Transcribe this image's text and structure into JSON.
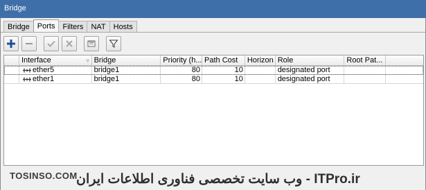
{
  "window": {
    "title": "Bridge"
  },
  "tabs": [
    {
      "label": "Bridge",
      "active": false
    },
    {
      "label": "Ports",
      "active": true
    },
    {
      "label": "Filters",
      "active": false
    },
    {
      "label": "NAT",
      "active": false
    },
    {
      "label": "Hosts",
      "active": false
    }
  ],
  "toolbar": {
    "add": "plus-icon",
    "remove": "minus-icon",
    "enable": "check-icon",
    "disable": "x-icon",
    "comment": "comment-icon",
    "filter": "filter-icon",
    "accent": "#1a4f9c"
  },
  "table": {
    "columns": [
      "",
      "Interface",
      "Bridge",
      "Priority (h...",
      "Path Cost",
      "Horizon",
      "Role",
      "Root Pat...",
      ""
    ],
    "rows": [
      {
        "interface": "ether5",
        "bridge": "bridge1",
        "priority": "80",
        "path_cost": "10",
        "horizon": "",
        "role": "designated port",
        "root_path": ""
      },
      {
        "interface": "ether1",
        "bridge": "bridge1",
        "priority": "80",
        "path_cost": "10",
        "horizon": "",
        "role": "designated port",
        "root_path": ""
      }
    ]
  },
  "watermark": {
    "left": "TOSINSO.COM",
    "right": "ITPro.ir - وب سایت تخصصی فناوری اطلاعات ایران"
  }
}
